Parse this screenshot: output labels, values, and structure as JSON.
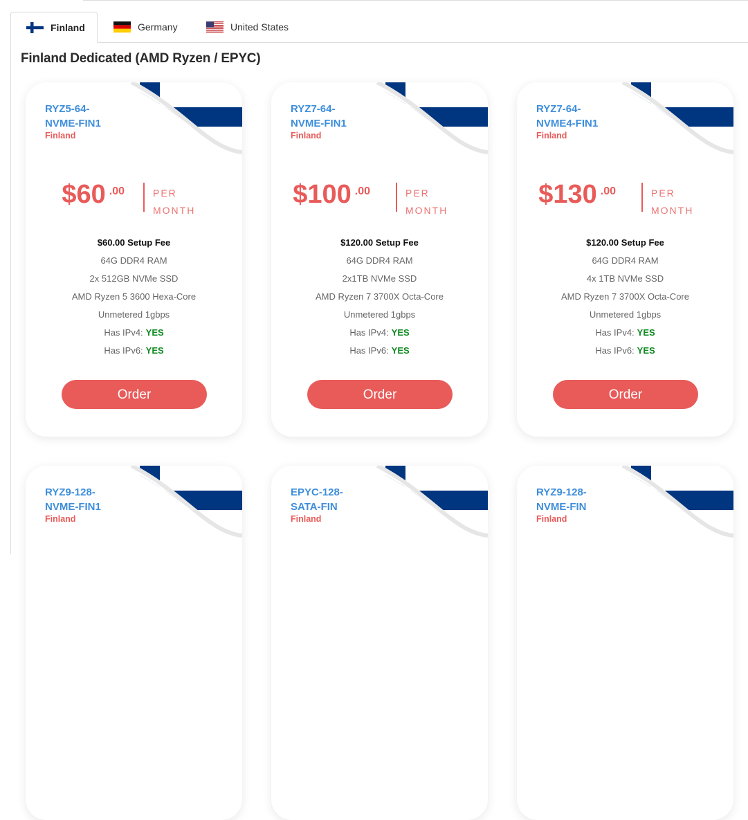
{
  "tabs": [
    {
      "label": "Finland",
      "icon": "finland-flag-icon",
      "active": true
    },
    {
      "label": "Germany",
      "icon": "germany-flag-icon",
      "active": false
    },
    {
      "label": "United States",
      "icon": "usa-flag-icon",
      "active": false
    }
  ],
  "section_title": "Finland Dedicated (AMD Ryzen / EPYC)",
  "colors": {
    "accent": "#e85b59",
    "link": "#3e8edb",
    "yes": "#0c8a1f",
    "flag_blue": "#003580"
  },
  "cards": [
    {
      "name": "RYZ5-64-NVME-FIN1",
      "name_line1": "RYZ5-64-",
      "name_line2": "NVME-FIN1",
      "location": "Finland",
      "price": "$60",
      "cents": ".00",
      "per_1": "PER",
      "per_2": "MONTH",
      "setup": "$60.00 Setup Fee",
      "ram": "64G DDR4 RAM",
      "disk": "2x 512GB NVMe SSD",
      "cpu": "AMD Ryzen 5 3600 Hexa-Core",
      "bandwidth": "Unmetered 1gbps",
      "ipv4_label": "Has IPv4:",
      "ipv4": "YES",
      "ipv6_label": "Has IPv6:",
      "ipv6": "YES",
      "order_label": "Order"
    },
    {
      "name": "RYZ7-64-NVME-FIN1",
      "name_line1": "RYZ7-64-",
      "name_line2": "NVME-FIN1",
      "location": "Finland",
      "price": "$100",
      "cents": ".00",
      "per_1": "PER",
      "per_2": "MONTH",
      "setup": "$120.00 Setup Fee",
      "ram": "64G DDR4 RAM",
      "disk": "2x1TB NVMe SSD",
      "cpu": "AMD Ryzen 7 3700X Octa-Core",
      "bandwidth": "Unmetered 1gbps",
      "ipv4_label": "Has IPv4:",
      "ipv4": "YES",
      "ipv6_label": "Has IPv6:",
      "ipv6": "YES",
      "order_label": "Order"
    },
    {
      "name": "RYZ7-64-NVME4-FIN1",
      "name_line1": "RYZ7-64-",
      "name_line2": "NVME4-FIN1",
      "location": "Finland",
      "price": "$130",
      "cents": ".00",
      "per_1": "PER",
      "per_2": "MONTH",
      "setup": "$120.00 Setup Fee",
      "ram": "64G DDR4 RAM",
      "disk": "4x 1TB NVMe SSD",
      "cpu": "AMD Ryzen 7 3700X Octa-Core",
      "bandwidth": "Unmetered 1gbps",
      "ipv4_label": "Has IPv4:",
      "ipv4": "YES",
      "ipv6_label": "Has IPv6:",
      "ipv6": "YES",
      "order_label": "Order"
    },
    {
      "name": "RYZ9-128-NVME-FIN1",
      "name_line1": "RYZ9-128-",
      "name_line2": "NVME-FIN1",
      "location": "Finland"
    },
    {
      "name": "EPYC-128-SATA-FIN",
      "name_line1": "EPYC-128-",
      "name_line2": "SATA-FIN",
      "location": "Finland"
    },
    {
      "name": "RYZ9-128-NVME-FIN",
      "name_line1": "RYZ9-128-",
      "name_line2": "NVME-FIN",
      "location": "Finland"
    }
  ]
}
